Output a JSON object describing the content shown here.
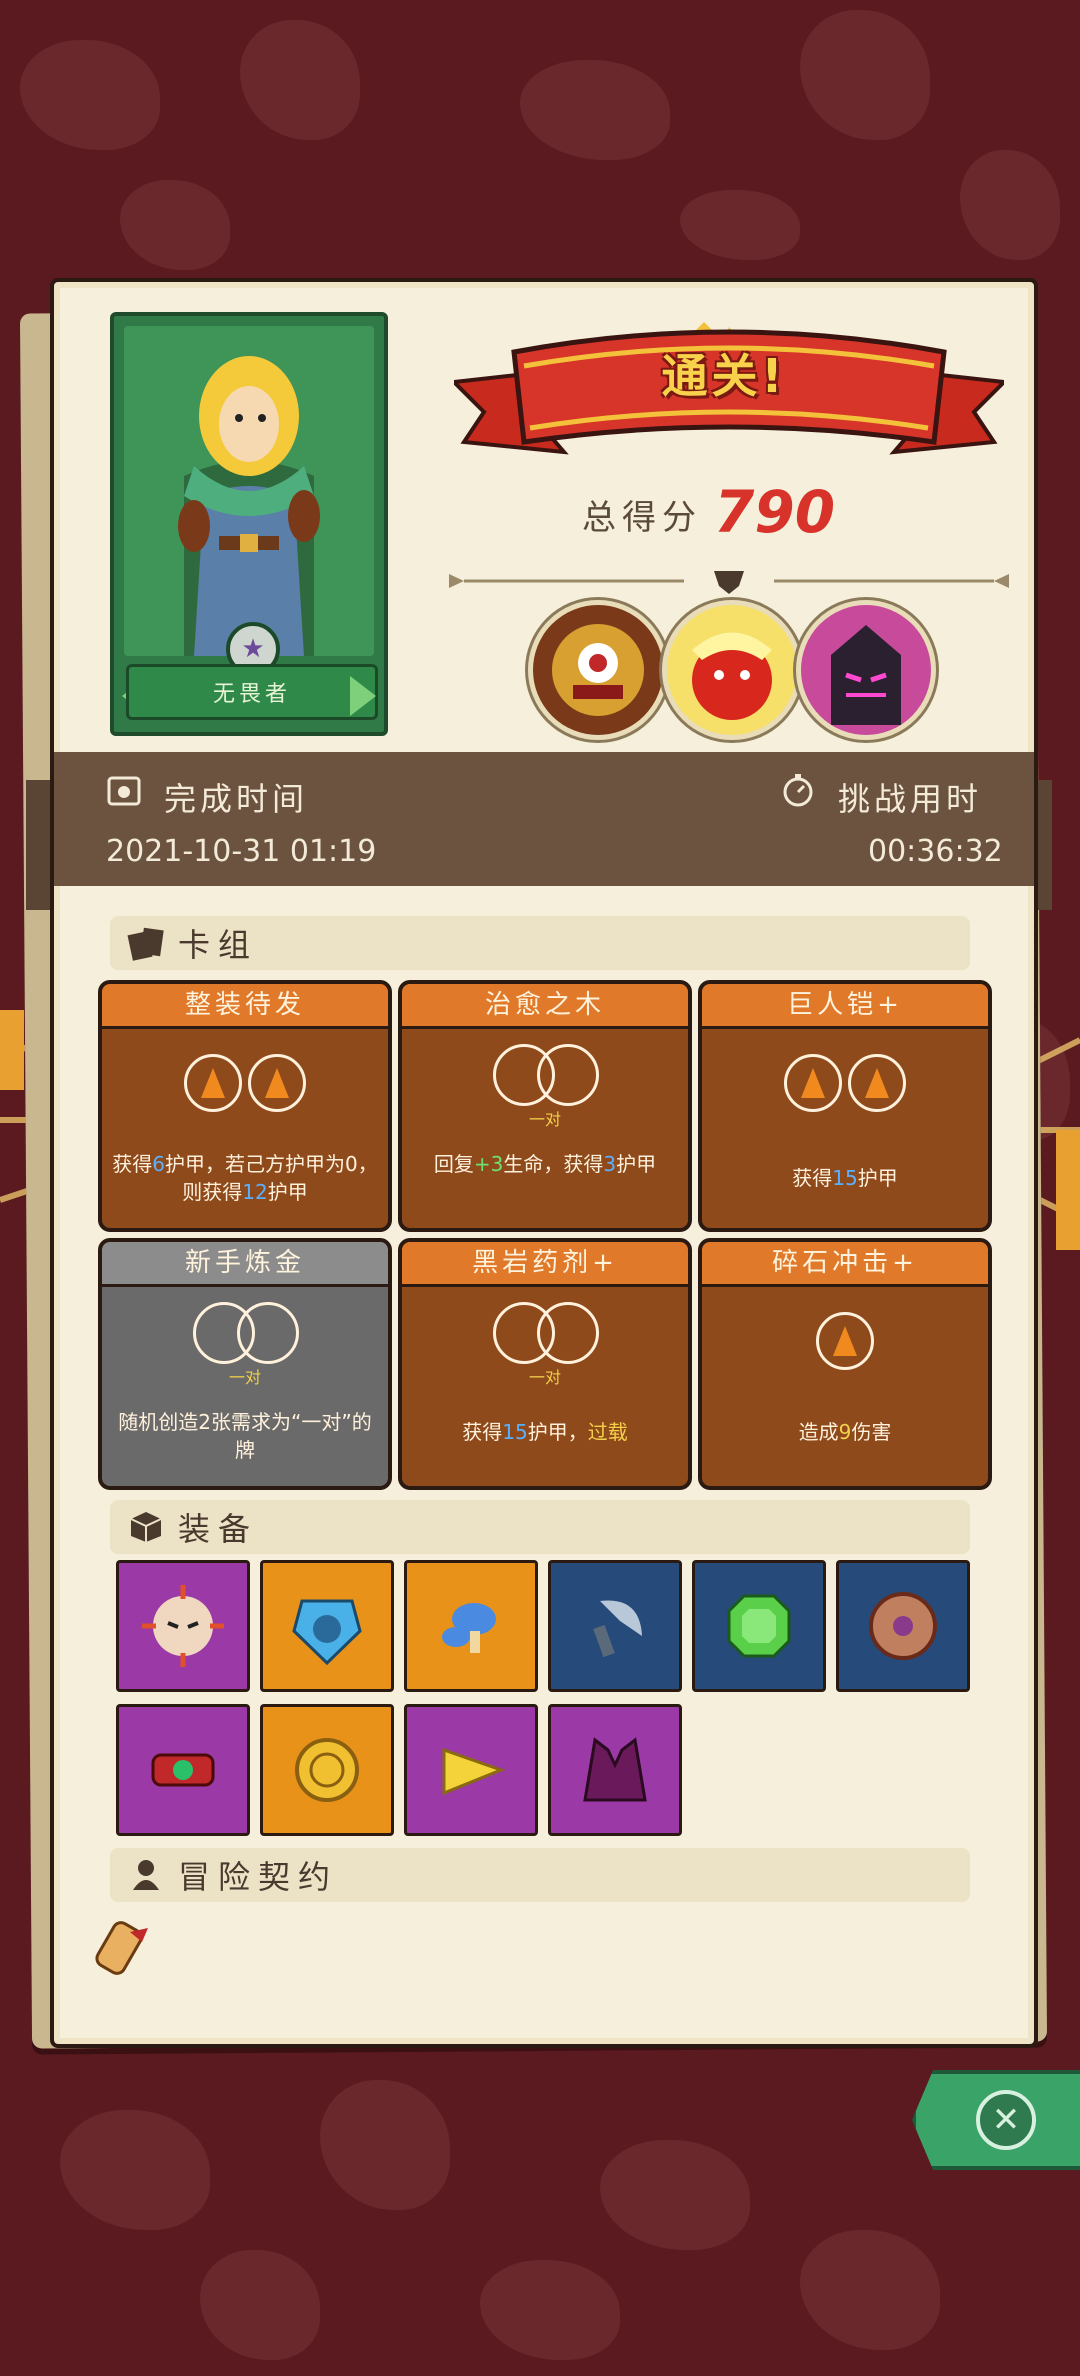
{
  "hero": {
    "name": "无畏者"
  },
  "result": {
    "banner": "通关!",
    "score_label": "总得分",
    "score": "790"
  },
  "time": {
    "complete_label": "完成时间",
    "complete_value": "2021-10-31 01:19",
    "challenge_label": "挑战用时",
    "challenge_value": "00:36:32"
  },
  "sections": {
    "deck": "卡组",
    "equipment": "装备",
    "contract": "冒险契约"
  },
  "cards": [
    {
      "title": "整装待发",
      "style": "orange",
      "slot": "gems2",
      "desc_parts": [
        "获得",
        "6",
        "护甲，若己方护甲为0，则获得",
        "12",
        "护甲"
      ]
    },
    {
      "title": "治愈之木",
      "style": "orange",
      "slot": "rings",
      "pair": "一对",
      "desc_parts": [
        "回复",
        "+3",
        "生命，获得",
        "3",
        "护甲"
      ]
    },
    {
      "title": "巨人铠+",
      "style": "orange",
      "slot": "gems2",
      "desc_parts": [
        "获得",
        "15",
        "护甲"
      ]
    },
    {
      "title": "新手炼金",
      "style": "gray",
      "slot": "rings",
      "pair": "一对",
      "desc_parts": [
        "随机创造2张需求为“一对”的牌"
      ]
    },
    {
      "title": "黑岩药剂+",
      "style": "orange",
      "slot": "rings",
      "pair": "一对",
      "desc_parts": [
        "获得",
        "15",
        "护甲，",
        "过载"
      ]
    },
    {
      "title": "碎石冲击+",
      "style": "orange",
      "slot": "gem1",
      "desc_parts": [
        "造成",
        "9",
        "伤害"
      ]
    }
  ],
  "equipment": [
    {
      "icon": "sun-mask-icon",
      "color": "purple"
    },
    {
      "icon": "pumpkin-shield-icon",
      "color": "orange"
    },
    {
      "icon": "mushroom-icon",
      "color": "orange"
    },
    {
      "icon": "dagger-icon",
      "color": "blue"
    },
    {
      "icon": "emerald-icon",
      "color": "blue"
    },
    {
      "icon": "round-shield-icon",
      "color": "blue"
    },
    {
      "icon": "bracelet-icon",
      "color": "purple"
    },
    {
      "icon": "gold-coin-icon",
      "color": "orange"
    },
    {
      "icon": "cheese-icon",
      "color": "purple"
    },
    {
      "icon": "vest-icon",
      "color": "purple"
    }
  ]
}
